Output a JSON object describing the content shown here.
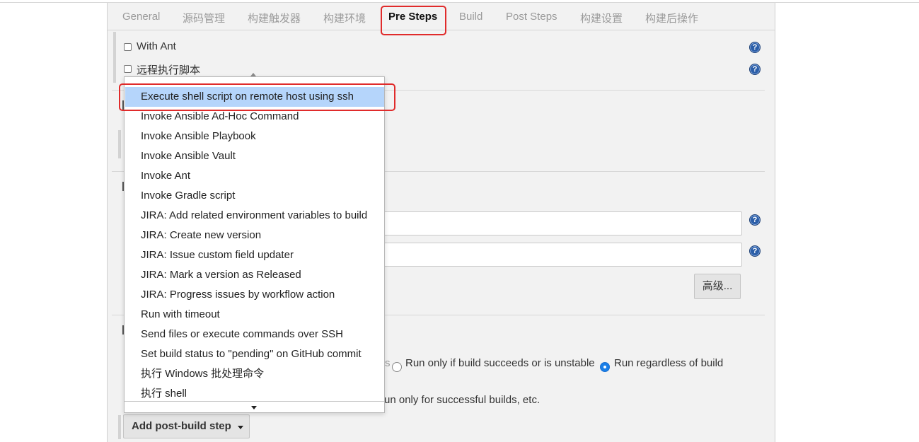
{
  "tabs": [
    {
      "label": "General"
    },
    {
      "label": "源码管理"
    },
    {
      "label": "构建触发器"
    },
    {
      "label": "构建环境"
    },
    {
      "label": "Pre Steps"
    },
    {
      "label": "Build"
    },
    {
      "label": "Post Steps"
    },
    {
      "label": "构建设置"
    },
    {
      "label": "构建后操作"
    }
  ],
  "active_tab": "Pre Steps",
  "highlight_color": "#e02b2b",
  "build_env": {
    "with_ant": "With Ant",
    "remote_script": "远程执行脚本"
  },
  "help_icon_glyph": "?",
  "dropdown": {
    "selected_index": 0,
    "items": [
      {
        "label": "Execute shell script on remote host using ssh"
      },
      {
        "label": "Invoke Ansible Ad-Hoc Command"
      },
      {
        "label": "Invoke Ansible Playbook"
      },
      {
        "label": "Invoke Ansible Vault"
      },
      {
        "label": "Invoke Ant"
      },
      {
        "label": "Invoke Gradle script"
      },
      {
        "label": "JIRA: Add related environment variables to build"
      },
      {
        "label": "JIRA: Create new version"
      },
      {
        "label": "JIRA: Issue custom field updater"
      },
      {
        "label": "JIRA: Mark a version as Released"
      },
      {
        "label": "JIRA: Progress issues by workflow action"
      },
      {
        "label": "Run with timeout"
      },
      {
        "label": "Send files or execute commands over SSH"
      },
      {
        "label": "Set build status to \"pending\" on GitHub commit"
      },
      {
        "label": "执行 Windows 批处理命令"
      },
      {
        "label": "执行 shell"
      }
    ]
  },
  "build": {
    "advanced_button": "高级..."
  },
  "post_steps": {
    "partial_radio_tail": "s",
    "radio_options": [
      {
        "label": "Run only if build succeeds or is unstable",
        "checked": false
      },
      {
        "label": "Run regardless of build",
        "checked": true
      }
    ],
    "note_tail": "un only for successful builds, etc.",
    "add_button": "Add post-build step"
  }
}
